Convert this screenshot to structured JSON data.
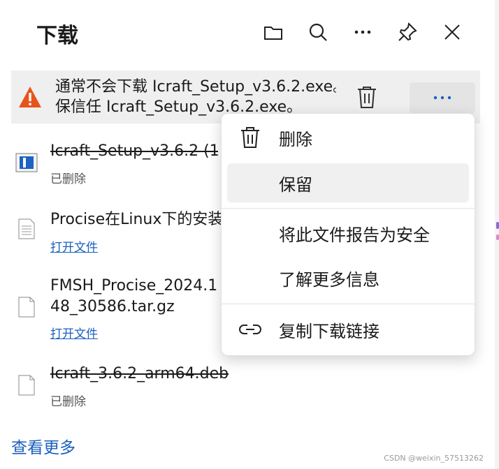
{
  "header": {
    "title": "下载",
    "icons": [
      "folder-icon",
      "search-icon",
      "more-icon",
      "pin-icon",
      "close-icon"
    ]
  },
  "warning_item": {
    "line1": "通常不会下载 Icraft_Setup_v3.6.2.exe。",
    "line2": "保信任 Icraft_Setup_v3.6.2.exe。",
    "icon": "warning-icon",
    "accent": "#e8531c"
  },
  "items": [
    {
      "name": "Icraft_Setup_v3.6.2 (1",
      "status": "已删除",
      "icon": "installer-icon"
    },
    {
      "name": "Procise在Linux下的安装",
      "link": "打开文件",
      "icon": "text-file-icon"
    },
    {
      "name_line1": "FMSH_Procise_2024.1",
      "name_line2": "48_30586.tar.gz",
      "link": "打开文件",
      "icon": "file-icon"
    },
    {
      "name": "Icraft_3.6.2_arm64.deb",
      "status": "已删除",
      "icon": "file-icon"
    }
  ],
  "see_more": "查看更多",
  "menu": {
    "items": [
      {
        "label": "删除",
        "icon": "trash-icon"
      },
      {
        "label": "保留",
        "icon": ""
      },
      {
        "label": "将此文件报告为安全",
        "icon": ""
      },
      {
        "label": "了解更多信息",
        "icon": ""
      },
      {
        "label": "复制下载链接",
        "icon": "link-icon"
      }
    ]
  },
  "watermark": "CSDN @weixin_57513262",
  "colors": {
    "link": "#1a5fbd",
    "warning": "#e8531c",
    "accent_edge": "#8a6bd8"
  }
}
